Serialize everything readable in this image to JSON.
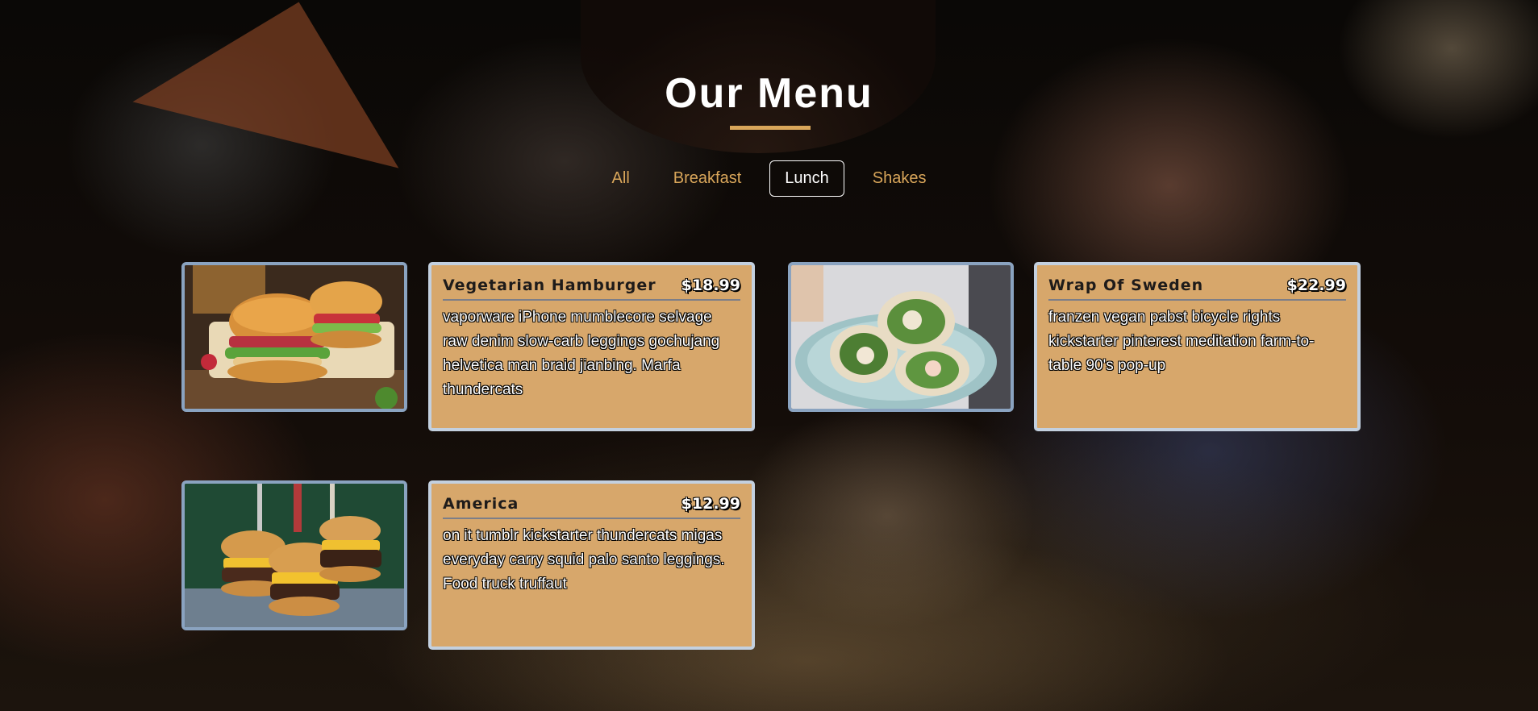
{
  "page": {
    "title": "Our Menu"
  },
  "filters": [
    {
      "label": "All",
      "active": false
    },
    {
      "label": "Breakfast",
      "active": false
    },
    {
      "label": "Lunch",
      "active": true
    },
    {
      "label": "Shakes",
      "active": false
    }
  ],
  "menu": {
    "items": [
      {
        "name": "Vegetarian Hamburger",
        "price": "$18.99",
        "description": "vaporware iPhone mumblecore selvage raw denim slow-carb leggings gochujang helvetica man braid jianbing. Marfa thundercats",
        "image_icon": "burger-photo"
      },
      {
        "name": "Wrap Of Sweden",
        "price": "$22.99",
        "description": "franzen vegan pabst bicycle rights kickstarter pinterest meditation farm-to-table 90's pop-up",
        "image_icon": "wrap-photo"
      },
      {
        "name": "America",
        "price": "$12.99",
        "description": "on it tumblr kickstarter thundercats migas everyday carry squid palo santo leggings. Food truck truffaut",
        "image_icon": "burgers-stack-photo"
      }
    ]
  },
  "colors": {
    "accent": "#d9a65a",
    "card_bg": "#d7a76b",
    "card_border": "#c3d0df",
    "image_border": "#8aa3c0"
  }
}
